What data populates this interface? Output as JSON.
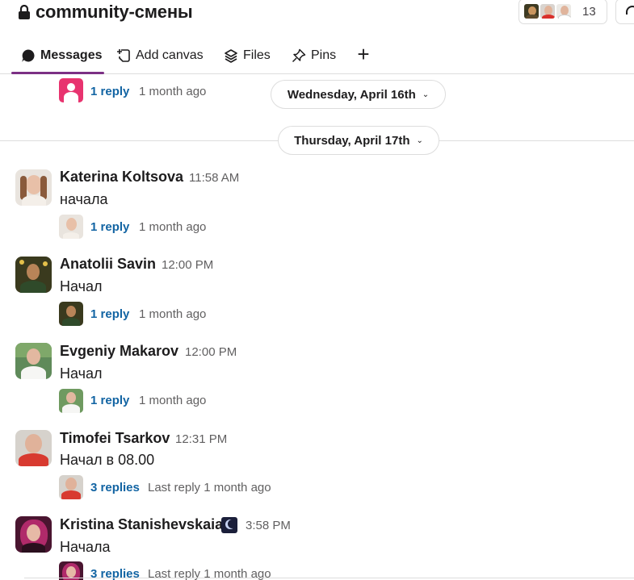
{
  "header": {
    "channel_name": "community-смены",
    "member_count": "13"
  },
  "tabs": [
    {
      "label": "Messages"
    },
    {
      "label": "Add canvas"
    },
    {
      "label": "Files"
    },
    {
      "label": "Pins"
    }
  ],
  "dividers": {
    "first": "Wednesday, April 16th",
    "second": "Thursday, April 17th"
  },
  "top_thread": {
    "reply_count": "1 reply",
    "reply_time": "1 month ago"
  },
  "messages": [
    {
      "author": "Katerina Koltsova",
      "time": "11:58 AM",
      "text": "начала",
      "reply_count": "1 reply",
      "reply_time": "1 month ago"
    },
    {
      "author": "Anatolii Savin",
      "time": "12:00 PM",
      "text": "Начал",
      "reply_count": "1 reply",
      "reply_time": "1 month ago"
    },
    {
      "author": "Evgeniy Makarov",
      "time": "12:00 PM",
      "text": "Начал",
      "reply_count": "1 reply",
      "reply_time": "1 month ago"
    },
    {
      "author": "Timofei Tsarkov",
      "time": "12:31 PM",
      "text": "Начал в 08.00",
      "reply_count": "3 replies",
      "reply_time": "Last reply 1 month ago"
    },
    {
      "author": "Kristina Stanishevskaia",
      "time": "3:58 PM",
      "text": "Начала",
      "reply_count": "3 replies",
      "reply_time": "Last reply 1 month ago"
    }
  ],
  "colors": {
    "accent": "#7c3085",
    "link": "#1264a3",
    "muted": "#616061"
  }
}
